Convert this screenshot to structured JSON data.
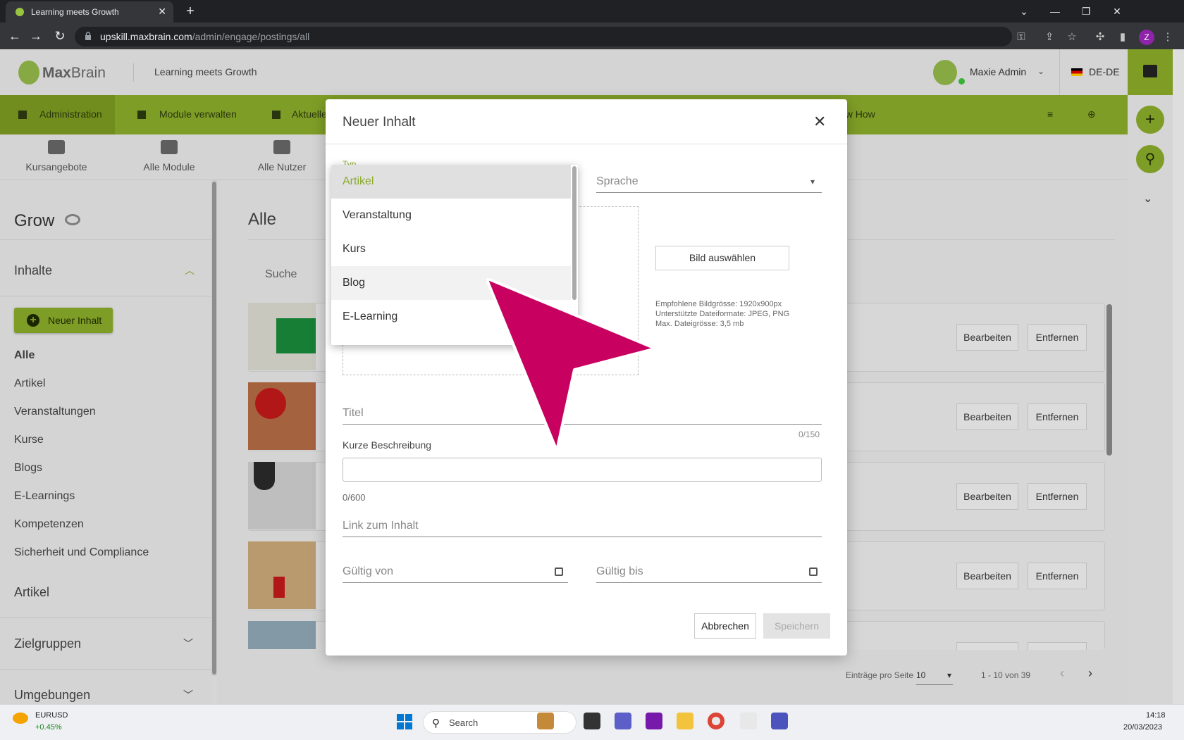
{
  "browser": {
    "tab_title": "Learning meets Growth",
    "url_host": "upskill.maxbrain.com",
    "url_path": "/admin/engage/postings/all",
    "profile_initial": "Z"
  },
  "app": {
    "logo_bold": "Max",
    "logo_rest": "Brain",
    "header_title": "Learning meets Growth",
    "user_name": "Maxie Admin",
    "language": "DE-DE"
  },
  "nav": {
    "items": [
      "Administration",
      "Module verwalten",
      "Aktuelle",
      "ow How"
    ]
  },
  "icon_tabs": [
    "Kursangebote",
    "Alle Module",
    "Alle Nutzer"
  ],
  "sidebar": {
    "title": "Grow",
    "section": "Inhalte",
    "new_button": "Neuer Inhalt",
    "items": [
      "Alle",
      "Artikel",
      "Veranstaltungen",
      "Kurse",
      "Blogs",
      "E-Learnings",
      "Kompetenzen",
      "Sicherheit und Compliance"
    ],
    "sub_heading": "Artikel",
    "groups": [
      "Zielgruppen",
      "Umgebungen"
    ]
  },
  "main": {
    "heading": "Alle",
    "search_label": "Suche",
    "edit_label": "Bearbeiten",
    "remove_label": "Entfernen",
    "per_page_label": "Einträge pro Seite",
    "per_page_value": "10",
    "range": "1 - 10 von 39"
  },
  "modal": {
    "title": "Neuer Inhalt",
    "type_label": "Typ",
    "language_label": "Sprache",
    "select_image": "Bild auswählen",
    "hint1": "Empfohlene Bildgrösse: 1920x900px",
    "hint2": "Unterstützte Dateiformate: JPEG, PNG",
    "hint3": "Max. Dateigrösse: 3,5 mb",
    "title_label": "Titel",
    "title_count": "0/150",
    "short_desc_label": "Kurze Beschreibung",
    "short_desc_count": "0/600",
    "link_label": "Link zum Inhalt",
    "valid_from": "Gültig von",
    "valid_to": "Gültig bis",
    "cancel": "Abbrechen",
    "save": "Speichern"
  },
  "dropdown": {
    "options": [
      "Artikel",
      "Veranstaltung",
      "Kurs",
      "Blog",
      "E-Learning"
    ],
    "selected": "Artikel",
    "hovered": "Blog"
  },
  "taskbar": {
    "ticker": "EURUSD",
    "ticker_change": "+0.45%",
    "search": "Search",
    "time": "14:18",
    "date": "20/03/2023"
  },
  "colors": {
    "brand_green": "#89ab2a",
    "annotation_arrow": "#c8005f"
  }
}
